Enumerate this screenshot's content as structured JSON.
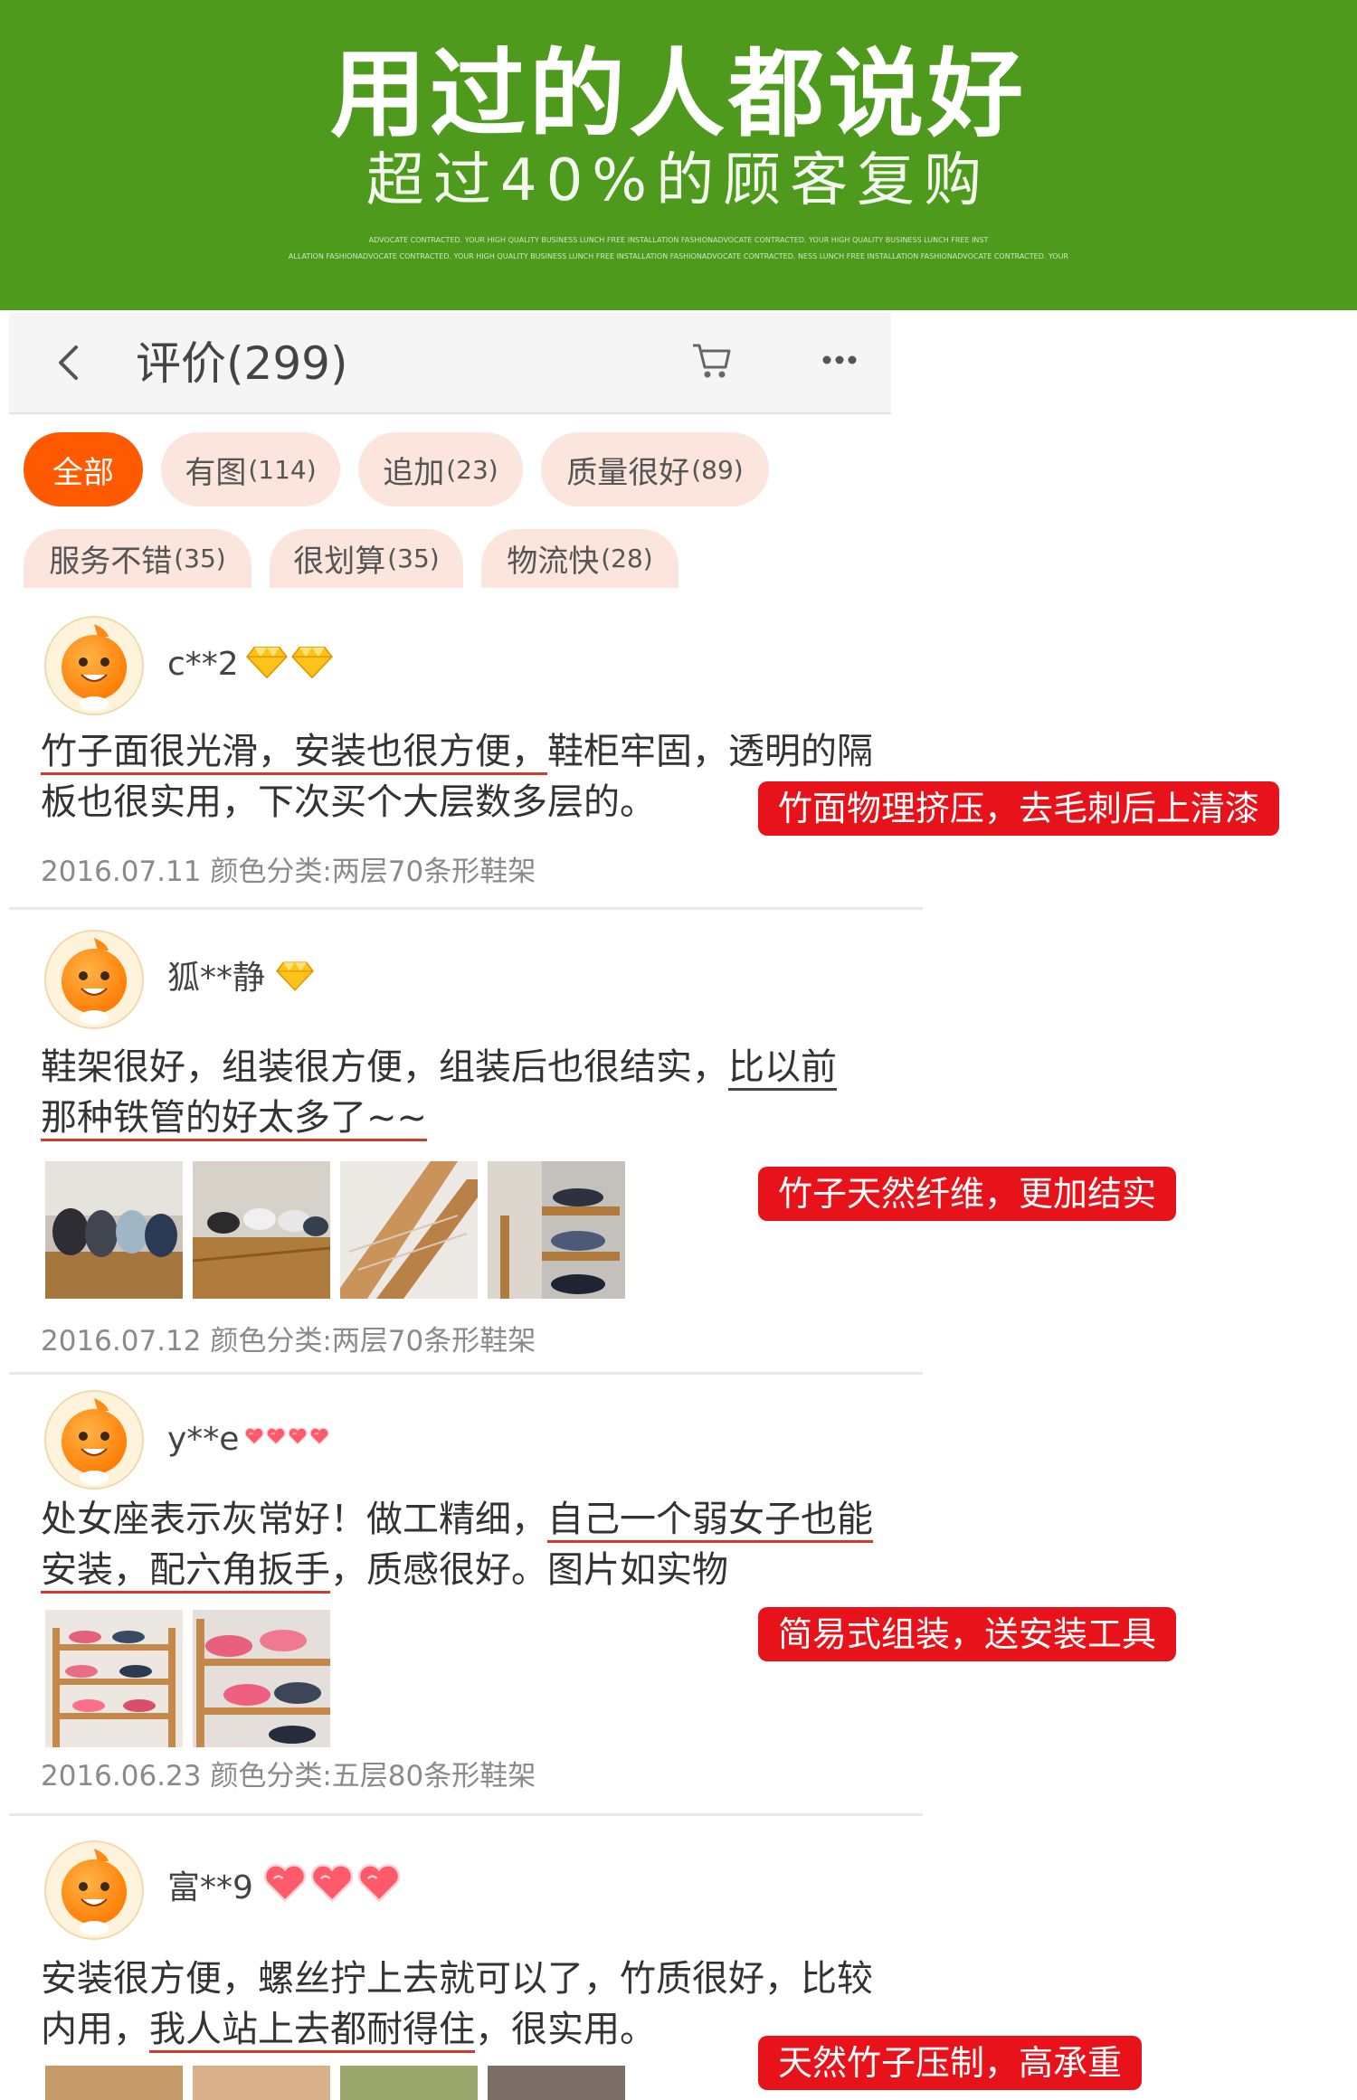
{
  "banner": {
    "title": "用过的人都说好",
    "subtitle": "超过40%的顾客复购",
    "fine_line_1": "ADVOCATE CONTRACTED. YOUR HIGH QUALITY BUSINESS LUNCH FREE INSTALLATION FASHIONADVOCATE CONTRACTED. YOUR HIGH QUALITY BUSINESS LUNCH FREE INST",
    "fine_line_2": "ALLATION FASHIONADVOCATE CONTRACTED. YOUR HIGH QUALITY BUSINESS LUNCH FREE INSTALLATION FASHIONADVOCATE CONTRACTED. NESS LUNCH FREE INSTALLATION FASHIONADVOCATE CONTRACTED. YOUR",
    "color": "#4d9a1c"
  },
  "header": {
    "title": "评价(299)",
    "back_icon": "chevron-left-icon",
    "cart_icon": "cart-icon",
    "more_icon": "more-icon"
  },
  "filters": [
    {
      "label": "全部",
      "count": "",
      "active": true
    },
    {
      "label": "有图",
      "count": "(114)",
      "active": false
    },
    {
      "label": "追加",
      "count": "(23)",
      "active": false
    },
    {
      "label": "质量很好",
      "count": "(89)",
      "active": false
    },
    {
      "label": "服务不错",
      "count": "(35)",
      "active": false
    },
    {
      "label": "很划算",
      "count": "(35)",
      "active": false
    },
    {
      "label": "物流快",
      "count": "(28)",
      "active": false
    }
  ],
  "reviews": [
    {
      "user": "c**2",
      "level_icon": "diamond-icon",
      "line1": {
        "u": "竹子面很光滑，安装也很方便，",
        "rest": "鞋柜牢固，透明的隔"
      },
      "line2": "板也很实用，下次买个大层数多层的。",
      "meta": "2016.07.11 颜色分类:两层70条形鞋架",
      "badge": "竹面物理挤压，去毛刺后上清漆"
    },
    {
      "user": "狐**静",
      "level_icon": "diamond-icon",
      "line1": {
        "pre": "鞋架很好，组装很方便，组装后也很结实，",
        "u": "比以前"
      },
      "line2": "那种铁管的好太多了~~",
      "meta": "2016.07.12 颜色分类:两层70条形鞋架",
      "badge": "竹子天然纤维，更加结实"
    },
    {
      "user": "y**e",
      "level_icon": "heart-icon",
      "line1": {
        "pre": "处女座表示灰常好！做工精细，",
        "u": "自己一个弱女子也能"
      },
      "line2": {
        "u": "安装，配六角扳手",
        "rest": "，质感很好。图片如实物"
      },
      "meta": "2016.06.23 颜色分类:五层80条形鞋架",
      "badge": "简易式组装，送安装工具"
    },
    {
      "user": "富**9",
      "level_icon": "heart-icon",
      "line1": "安装很方便，螺丝拧上去就可以了，竹质很好，比较",
      "line2": {
        "pre": "内用，",
        "u": "我人站上去都耐得住",
        "rest": "，很实用。"
      },
      "badge": "天然竹子压制，高承重"
    }
  ],
  "accent": "#ff5a00",
  "badge_color": "#e8121a"
}
